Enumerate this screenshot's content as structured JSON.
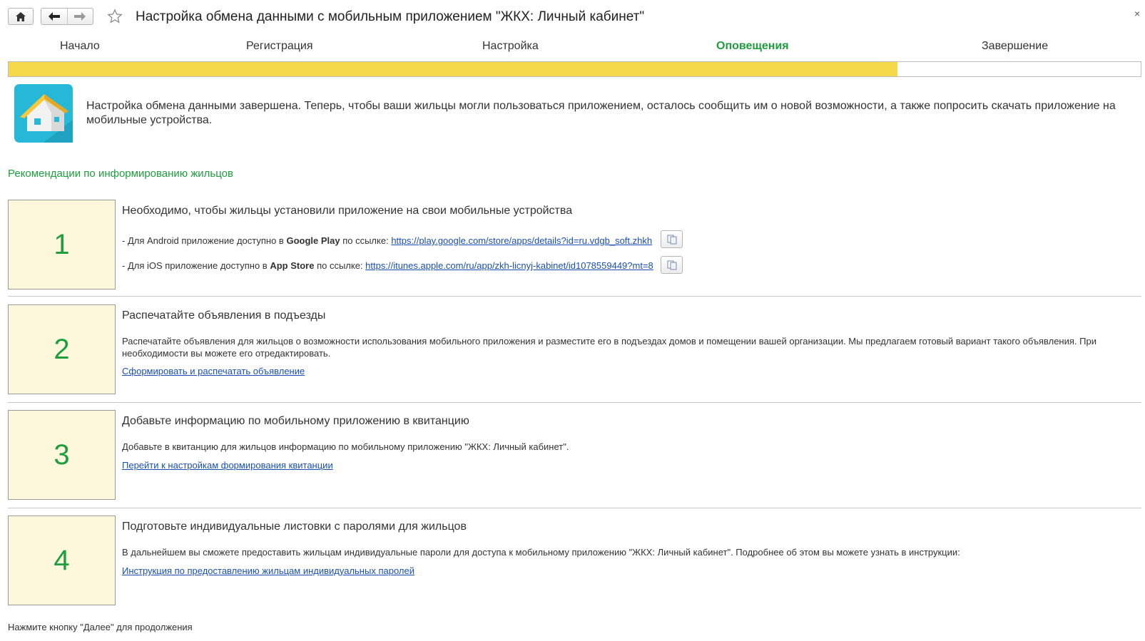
{
  "window": {
    "title": "Настройка обмена данными с мобильным приложением \"ЖКХ: Личный кабинет\"",
    "close_label": "×"
  },
  "steps": [
    {
      "label": "Начало",
      "active": false
    },
    {
      "label": "Регистрация",
      "active": false
    },
    {
      "label": "Настройка",
      "active": false
    },
    {
      "label": "Оповещения",
      "active": true
    },
    {
      "label": "Завершение",
      "active": false
    }
  ],
  "progress": {
    "fraction": 0.785,
    "color": "#f6d84b"
  },
  "intro": {
    "text": "Настройка обмена данными завершена. Теперь, чтобы ваши жильцы могли пользоваться приложением, осталось сообщить им о новой возможности, а также попросить скачать приложение на мобильные устройства."
  },
  "recommendations": {
    "title": "Рекомендации по информированию жильцов",
    "items": [
      {
        "number": "1",
        "heading": "Необходимо, чтобы жильцы установили приложение на свои мобильные устройства",
        "android": {
          "prefix": "- Для Android приложение доступно в ",
          "store": "Google Play",
          "suffix": " по ссылке: ",
          "url": "https://play.google.com/store/apps/details?id=ru.vdgb_soft.zhkh"
        },
        "ios": {
          "prefix": "- Для iOS приложение доступно в ",
          "store": "App Store",
          "suffix": " по ссылке: ",
          "url": "https://itunes.apple.com/ru/app/zkh-licnyj-kabinet/id1078559449?mt=8"
        }
      },
      {
        "number": "2",
        "heading": "Распечатайте объявления в подъезды",
        "text": "Распечатайте объявления для жильцов о возможности использования мобильного приложения и разместите его в подъездах домов и помещении вашей организации. Мы предлагаем готовый вариант такого объявления. При необходимости вы можете его отредактировать.",
        "link": "Сформировать и распечатать объявление"
      },
      {
        "number": "3",
        "heading": "Добавьте информацию по мобильному приложению в квитанцию",
        "text": "Добавьте в квитанцию для жильцов информацию по мобильному приложению \"ЖКХ: Личный кабинет\".",
        "link": "Перейти к настройкам формирования квитанции"
      },
      {
        "number": "4",
        "heading": "Подготовьте индивидуальные листовки с паролями для жильцов",
        "text": "В дальнейшем вы сможете предоставить жильцам индивидуальные пароли для доступа к мобильному приложению \"ЖКХ: Личный кабинет\". Подробнее об этом вы можете узнать в инструкции:",
        "link": "Инструкция по предоставлению жильцам индивидуальных паролей"
      }
    ]
  },
  "footer": {
    "text": "Нажмите кнопку \"Далее\" для продолжения"
  },
  "icons": {
    "home": "home-icon",
    "back": "arrow-left-icon",
    "forward": "arrow-right-icon",
    "favorite": "star-icon",
    "close": "close-icon",
    "copy": "copy-icon",
    "app": "house-app-icon"
  },
  "colors": {
    "accent_green": "#1e9e3e",
    "number_box_bg": "#fdf7dc",
    "link": "#1a4fb5"
  }
}
